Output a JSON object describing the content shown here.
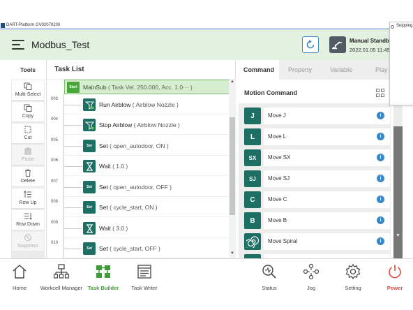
{
  "window": {
    "title": "DART-Platform GV02070200"
  },
  "header": {
    "project_name": "Modbus_Test",
    "mode": "Manual Standby",
    "datetime": "2022.01.05 11:45:3"
  },
  "snipping": {
    "label": "Snipping"
  },
  "tools": {
    "title": "Tools",
    "items": [
      {
        "label": "Multi-Select",
        "enabled": true,
        "icon": "multi-select-icon"
      },
      {
        "label": "Copy",
        "enabled": true,
        "icon": "copy-icon"
      },
      {
        "label": "Cut",
        "enabled": true,
        "icon": "cut-icon"
      },
      {
        "label": "Paste",
        "enabled": false,
        "icon": "paste-icon"
      },
      {
        "label": "Delete",
        "enabled": true,
        "icon": "delete-icon"
      },
      {
        "label": "Row Up",
        "enabled": true,
        "icon": "row-up-icon"
      },
      {
        "label": "Row Down",
        "enabled": true,
        "icon": "row-down-icon"
      },
      {
        "label": "Suppress",
        "enabled": false,
        "icon": "suppress-icon"
      }
    ]
  },
  "task_list": {
    "title": "Task List",
    "start": {
      "icon_text": "Start",
      "label": "MainSub",
      "params": "( Task Vel. 250.000, Acc. 1.0··· )"
    },
    "rows": [
      {
        "line": "003",
        "icon": "airblow-icon",
        "icon_text": "",
        "label": "Run Airblow",
        "params": "( Airblow Nozzle )"
      },
      {
        "line": "004",
        "icon": "airblow-icon",
        "icon_text": "",
        "label": "Stop Airblow",
        "params": "( Airblow Nozzle )"
      },
      {
        "line": "005",
        "icon": "set-icon",
        "icon_text": "Set",
        "label": "Set",
        "params": "( open_autodoor, ON )"
      },
      {
        "line": "006",
        "icon": "wait-icon",
        "icon_text": "",
        "label": "Wait",
        "params": "( 1.0 )"
      },
      {
        "line": "007",
        "icon": "set-icon",
        "icon_text": "Set",
        "label": "Set",
        "params": "( open_autodoor, OFF )"
      },
      {
        "line": "008",
        "icon": "set-icon",
        "icon_text": "Set",
        "label": "Set",
        "params": "( cycle_start, ON )"
      },
      {
        "line": "009",
        "icon": "wait-icon",
        "icon_text": "",
        "label": "Wait",
        "params": "( 3.0 )"
      },
      {
        "line": "010",
        "icon": "set-icon",
        "icon_text": "Set",
        "label": "Set",
        "params": "( cycle_start, OFF )"
      }
    ]
  },
  "command_panel": {
    "tabs": [
      {
        "label": "Command",
        "active": true
      },
      {
        "label": "Property",
        "active": false
      },
      {
        "label": "Variable",
        "active": false
      },
      {
        "label": "Play",
        "active": false
      }
    ],
    "section_title": "Motion Command",
    "commands": [
      {
        "label": "Move J",
        "icon_text": "J",
        "icon": "move-j-icon"
      },
      {
        "label": "Move L",
        "icon_text": "L",
        "icon": "move-l-icon"
      },
      {
        "label": "Move SX",
        "icon_text": "SX",
        "icon": "move-sx-icon"
      },
      {
        "label": "Move SJ",
        "icon_text": "SJ",
        "icon": "move-sj-icon"
      },
      {
        "label": "Move C",
        "icon_text": "C",
        "icon": "move-c-icon"
      },
      {
        "label": "Move B",
        "icon_text": "B",
        "icon": "move-b-icon"
      },
      {
        "label": "Move Spiral",
        "icon_text": "",
        "icon": "move-spiral-icon"
      }
    ],
    "info_symbol": "i"
  },
  "bottom_nav": [
    {
      "label": "Home",
      "icon": "home-icon",
      "active": false
    },
    {
      "label": "Workcell Manager",
      "icon": "workcell-manager-icon",
      "active": false
    },
    {
      "label": "Task Builder",
      "icon": "task-builder-icon",
      "active": true
    },
    {
      "label": "Task Writer",
      "icon": "task-writer-icon",
      "active": false
    },
    {
      "label": "Status",
      "icon": "status-icon",
      "active": false
    },
    {
      "label": "Jog",
      "icon": "jog-icon",
      "active": false
    },
    {
      "label": "Setting",
      "icon": "setting-icon",
      "active": false
    },
    {
      "label": "Power",
      "icon": "power-icon",
      "active": false
    }
  ],
  "colors": {
    "header_bg": "#e3f1e1",
    "accent_green": "#3f9d35",
    "command_teal": "#1d6e63",
    "info_blue": "#3b87c8",
    "power_red": "#e04a3a"
  }
}
